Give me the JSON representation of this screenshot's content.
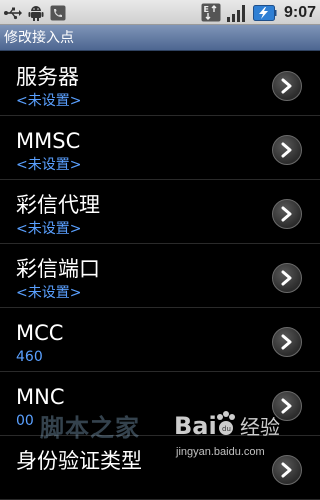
{
  "status_bar": {
    "time": "9:07",
    "left_icons": [
      "usb-icon",
      "android-debug-icon",
      "phone-call-icon"
    ],
    "right_icons": [
      "network-type-icon",
      "signal-strength-icon",
      "battery-charging-icon"
    ]
  },
  "header": {
    "title": "修改接入点"
  },
  "list": {
    "items": [
      {
        "label": "服务器",
        "value": "<未设置>"
      },
      {
        "label": "MMSC",
        "value": "<未设置>"
      },
      {
        "label": "彩信代理",
        "value": "<未设置>"
      },
      {
        "label": "彩信端口",
        "value": "<未设置>"
      },
      {
        "label": "MCC",
        "value": "460"
      },
      {
        "label": "MNC",
        "value": "00"
      },
      {
        "label": "身份验证类型",
        "value": ""
      }
    ]
  },
  "watermark": {
    "site_text": "脚本之家",
    "baidu_text": "Baidu经验",
    "url": "jingyan.baidu.com"
  },
  "colors": {
    "accent_value": "#5aa0ff",
    "title_bar": "#5f78a3",
    "background": "#000000"
  }
}
